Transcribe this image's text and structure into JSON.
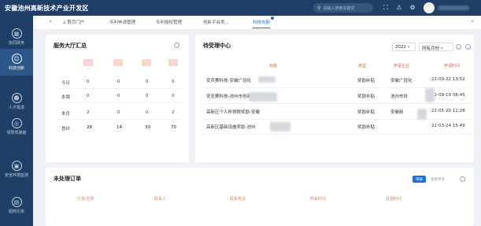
{
  "app": {
    "title": "安徽池州高新技术产业开发区"
  },
  "header": {
    "search_placeholder": "请输入搜索关键词"
  },
  "sidebar": {
    "items": [
      {
        "label": "协同政务",
        "icon": "grid-icon"
      },
      {
        "label": "科技创新",
        "icon": "lightbulb-icon"
      },
      {
        "label": "人才需求",
        "icon": "person-icon"
      },
      {
        "label": "领导驾驶舱",
        "icon": "gauge-icon"
      },
      {
        "label": "安全环境监测",
        "icon": "monitor-icon"
      },
      {
        "label": "招商引资",
        "icon": "building-icon"
      }
    ]
  },
  "tabs": [
    {
      "label": "首页门户"
    },
    {
      "label": "专利申请管理"
    },
    {
      "label": "专利授权管理"
    },
    {
      "label": "创新平台类..."
    },
    {
      "label": "科技创新"
    }
  ],
  "summary": {
    "title": "服务大厅汇总",
    "row_labels": [
      "今日",
      "本周",
      "本月",
      "总计"
    ],
    "rows": [
      [
        "0",
        "0",
        "0",
        "0"
      ],
      [
        "0",
        "0",
        "0",
        "0"
      ],
      [
        "2",
        "0",
        "0",
        "2"
      ],
      [
        "28",
        "14",
        "30",
        "70"
      ]
    ]
  },
  "pending": {
    "title": "待受理中心",
    "year": "2022",
    "filter": "所有月份",
    "headers": [
      "标题",
      "类型",
      "申请企业",
      "申请时间"
    ],
    "rows": [
      {
        "title": "安庆赛科技-安徽广冠化",
        "type": "奖励补贴",
        "company": "安徽广冠化",
        "time": "22-09-22 13:52"
      },
      {
        "title": "安庆赛科技-池州市创新赛",
        "type": "奖励补贴",
        "company": "池州市协",
        "time": "22-09-19 08:45"
      },
      {
        "title": "高新区个人所得税奖励-安徽",
        "type": "奖励补贴",
        "company": "安徽新",
        "time": "22-05-20 11:28"
      },
      {
        "title": "高新区基础设施奖励-池州",
        "type": "奖励补贴",
        "company": "",
        "time": "22-03-24 15:49"
      }
    ]
  },
  "orders": {
    "title": "未处理订单",
    "btn_primary": "审核",
    "btn_secondary": "查看更多",
    "headers": [
      "订单/名称",
      "联系人",
      "联系电话",
      "所属时间",
      "处理时间"
    ]
  },
  "colors": {
    "nav_bg": "#1f3f66",
    "accent": "#1f6fd6",
    "summary_swatches": [
      "#f8d8cd",
      "#f8d8cd",
      "#f8d8cd",
      "#f8d8cd"
    ]
  }
}
